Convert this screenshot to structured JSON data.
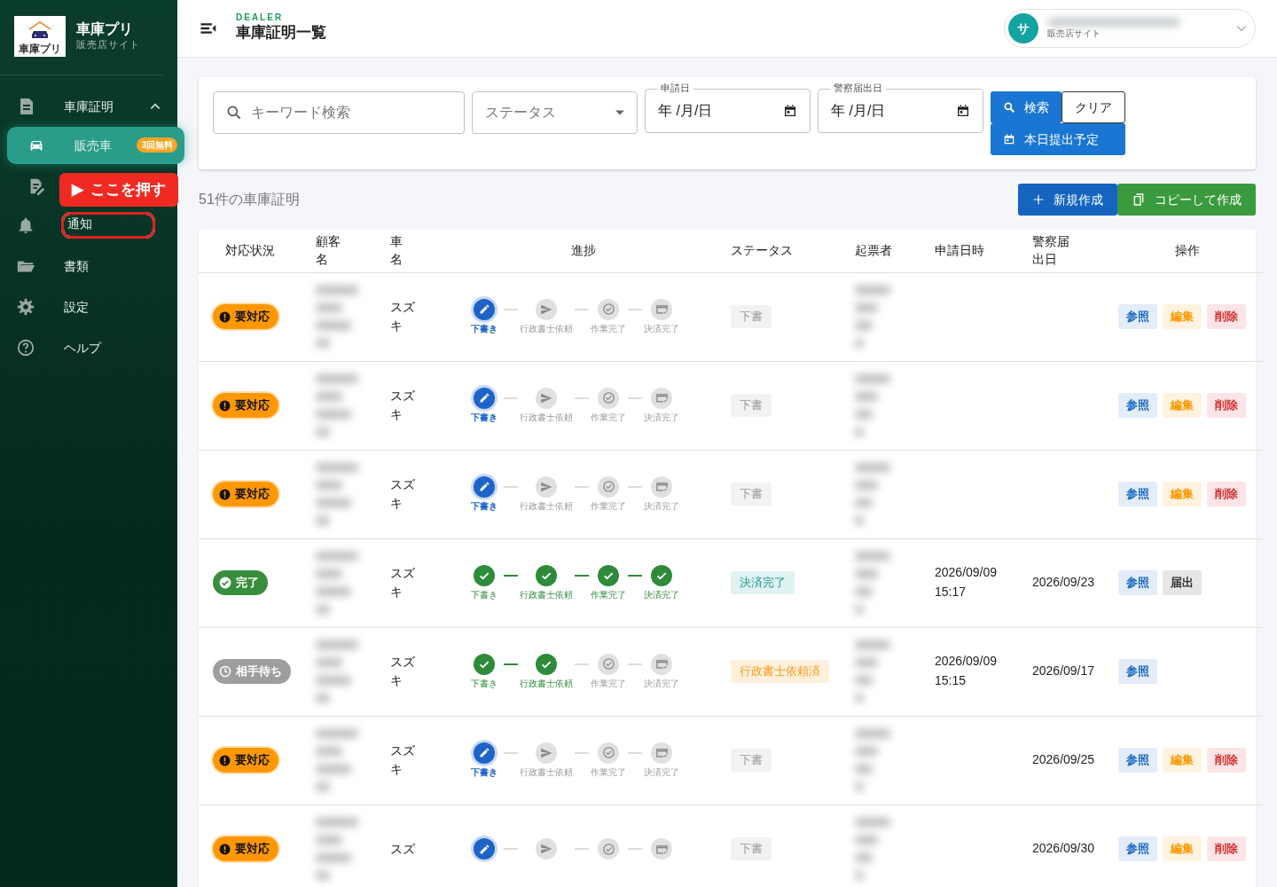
{
  "sidebar": {
    "logo_text": "車庫プリ",
    "app_name": "車庫プリ",
    "subtitle": "販売店サイト",
    "items": [
      {
        "label": "車庫証明",
        "expanded": true,
        "children": [
          {
            "label": "販売車",
            "selected": true,
            "badge": "3回無料"
          },
          {
            "selected": false
          }
        ]
      },
      {
        "label": "通知",
        "highlighted": true
      },
      {
        "label": "書類"
      },
      {
        "label": "設定"
      },
      {
        "label": "ヘルプ"
      }
    ],
    "callout": {
      "marker": "▶",
      "text": "ここを押す"
    }
  },
  "header": {
    "eyebrow": "DEALER",
    "title": "車庫証明一覧",
    "user": {
      "avatar": "サ",
      "role": "販売店サイト"
    }
  },
  "filters": {
    "keyword": {
      "placeholder": "キーワード検索"
    },
    "status": {
      "placeholder": "ステータス"
    },
    "dates": [
      {
        "label": "申請日",
        "value": "年 /月/日"
      },
      {
        "label": "警察届出日",
        "value": "年 /月/日"
      }
    ],
    "buttons": [
      {
        "kind": "search",
        "label": "検索"
      },
      {
        "kind": "clear",
        "label": "クリア"
      },
      {
        "kind": "today",
        "label": "本日提出予定"
      }
    ]
  },
  "list": {
    "count": "51件の車庫証明",
    "buttons": [
      {
        "kind": "new",
        "label": "新規作成"
      },
      {
        "kind": "copy",
        "label": "コピーして作成"
      }
    ]
  },
  "table": {
    "columns": [
      "対応状況",
      "顧客名",
      "車名",
      "進捗",
      "ステータス",
      "起票者",
      "申請日時",
      "警察届出日",
      "操作"
    ],
    "rows": [
      {
        "response": {
          "kind": "required",
          "label": "要対応"
        },
        "car": "スズキ",
        "steps": [
          {
            "label": "下書き",
            "done": false,
            "current": true
          },
          {
            "label": "行政書士依頼",
            "done": false,
            "current": false
          },
          {
            "label": "作業完了",
            "done": false,
            "current": false
          },
          {
            "label": "決済完了",
            "done": false,
            "current": false
          }
        ],
        "status": {
          "kind": "draft",
          "label": "下書"
        },
        "actions": [
          {
            "kind": "view",
            "label": "参照"
          },
          {
            "kind": "edit",
            "label": "編集"
          },
          {
            "kind": "delete",
            "label": "削除"
          }
        ]
      },
      {
        "response": {
          "kind": "required",
          "label": "要対応"
        },
        "car": "スズキ",
        "steps": [
          {
            "label": "下書き",
            "done": false,
            "current": true
          },
          {
            "label": "行政書士依頼",
            "done": false,
            "current": false
          },
          {
            "label": "作業完了",
            "done": false,
            "current": false
          },
          {
            "label": "決済完了",
            "done": false,
            "current": false
          }
        ],
        "status": {
          "kind": "draft",
          "label": "下書"
        },
        "actions": [
          {
            "kind": "view",
            "label": "参照"
          },
          {
            "kind": "edit",
            "label": "編集"
          },
          {
            "kind": "delete",
            "label": "削除"
          }
        ]
      },
      {
        "response": {
          "kind": "required",
          "label": "要対応"
        },
        "car": "スズキ",
        "steps": [
          {
            "label": "下書き",
            "done": false,
            "current": true
          },
          {
            "label": "行政書士依頼",
            "done": false,
            "current": false
          },
          {
            "label": "作業完了",
            "done": false,
            "current": false
          },
          {
            "label": "決済完了",
            "done": false,
            "current": false
          }
        ],
        "status": {
          "kind": "draft",
          "label": "下書"
        },
        "actions": [
          {
            "kind": "view",
            "label": "参照"
          },
          {
            "kind": "edit",
            "label": "編集"
          },
          {
            "kind": "delete",
            "label": "削除"
          }
        ]
      },
      {
        "response": {
          "kind": "done",
          "label": "完了"
        },
        "car": "スズキ",
        "steps": [
          {
            "label": "下書き",
            "done": true,
            "current": false
          },
          {
            "label": "行政書士依頼",
            "done": true,
            "current": false
          },
          {
            "label": "作業完了",
            "done": true,
            "current": false
          },
          {
            "label": "決済完了",
            "done": true,
            "current": false
          }
        ],
        "status": {
          "kind": "paid",
          "label": "決済完了"
        },
        "applied": "2026/09/09 15:17",
        "police_date": "2026/09/23",
        "actions": [
          {
            "kind": "view",
            "label": "参照"
          },
          {
            "kind": "submit",
            "label": "届出"
          }
        ]
      },
      {
        "response": {
          "kind": "waiting",
          "label": "相手待ち"
        },
        "car": "スズキ",
        "steps": [
          {
            "label": "下書き",
            "done": true,
            "current": false
          },
          {
            "label": "行政書士依頼",
            "done": true,
            "current": false
          },
          {
            "label": "作業完了",
            "done": false,
            "current": false
          },
          {
            "label": "決済完了",
            "done": false,
            "current": false
          }
        ],
        "status": {
          "kind": "requested",
          "label": "行政書士依頼済"
        },
        "applied": "2026/09/09 15:15",
        "police_date": "2026/09/17",
        "actions": [
          {
            "kind": "view",
            "label": "参照"
          }
        ]
      },
      {
        "response": {
          "kind": "required",
          "label": "要対応"
        },
        "car": "スズキ",
        "steps": [
          {
            "label": "下書き",
            "done": false,
            "current": true
          },
          {
            "label": "行政書士依頼",
            "done": false,
            "current": false
          },
          {
            "label": "作業完了",
            "done": false,
            "current": false
          },
          {
            "label": "決済完了",
            "done": false,
            "current": false
          }
        ],
        "status": {
          "kind": "draft",
          "label": "下書"
        },
        "police_date": "2026/09/25",
        "actions": [
          {
            "kind": "view",
            "label": "参照"
          },
          {
            "kind": "edit",
            "label": "編集"
          },
          {
            "kind": "delete",
            "label": "削除"
          }
        ]
      },
      {
        "response": {
          "kind": "required",
          "label": "要対応"
        },
        "car": "スズ",
        "steps": [
          {
            "done": false,
            "current": true
          },
          {
            "done": false,
            "current": false
          },
          {
            "done": false,
            "current": false
          },
          {
            "done": false,
            "current": false
          }
        ],
        "status": {
          "kind": "draft",
          "label": "下書"
        },
        "police_date": "2026/09/30",
        "actions": [
          {
            "kind": "view",
            "label": "参照"
          },
          {
            "kind": "edit",
            "label": "編集"
          },
          {
            "kind": "delete",
            "label": "削除"
          }
        ]
      }
    ]
  }
}
